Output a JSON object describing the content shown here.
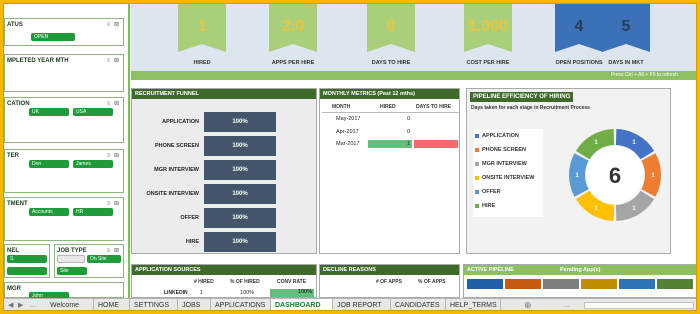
{
  "slicers": [
    {
      "title": "ATUS",
      "chips": [
        "OPEN"
      ]
    },
    {
      "title": "MPLETED YEAR MTH",
      "chips": []
    },
    {
      "title": "CATION",
      "chips": [
        "UK",
        "USA"
      ]
    },
    {
      "title": "TER",
      "chips": [
        "Don",
        "James"
      ]
    },
    {
      "title": "TMENT",
      "chips": [
        "Accounts",
        "HR"
      ]
    },
    {
      "title": "NEL",
      "chips": [
        "S",
        ""
      ]
    },
    {
      "title": "JOB TYPE",
      "chips": [
        "On Site",
        "Site"
      ]
    },
    {
      "title": "MGR",
      "chips": [
        "John"
      ]
    }
  ],
  "slicer_icons": "≡ ⊠",
  "kpis": [
    {
      "value": "1",
      "label": "HIRED",
      "color": "#a9cf7b",
      "text_color": "#e9c43f"
    },
    {
      "value": "2.0",
      "label": "APPS PER HIRE",
      "color": "#a9cf7b",
      "text_color": "#e9c43f"
    },
    {
      "value": "0",
      "label": "DAYS TO HIRE",
      "color": "#a9cf7b",
      "text_color": "#e9c43f"
    },
    {
      "value": "1,000",
      "label": "COST PER HIRE",
      "color": "#a9cf7b",
      "text_color": "#e9c43f"
    },
    {
      "value": "4",
      "label": "OPEN POSITIONS",
      "color": "#3b72b7",
      "text_color": "#2a3c55"
    },
    {
      "value": "5",
      "label": "DAYS IN MKT",
      "color": "#3b72b7",
      "text_color": "#2a3c55"
    }
  ],
  "refresh_hint": "Press Ctrl + Alt + F5 to refresh",
  "funnel": {
    "title": "RECRUITMENT FUNNEL",
    "rows": [
      {
        "label": "APPLICATION",
        "value": "100%"
      },
      {
        "label": "PHONE SCREEN",
        "value": "100%"
      },
      {
        "label": "MGR INTERVIEW",
        "value": "100%"
      },
      {
        "label": "ONSITE INTERVIEW",
        "value": "100%"
      },
      {
        "label": "OFFER",
        "value": "100%"
      },
      {
        "label": "HIRE",
        "value": "100%"
      }
    ]
  },
  "monthly": {
    "title": "MONTHLY METRICS (Past 12 mths)",
    "headers": [
      "MONTH",
      "HIRED",
      "DAYS TO HIRE"
    ],
    "rows": [
      {
        "month": "May-2017",
        "hired": "0",
        "days": ""
      },
      {
        "month": "Apr-2017",
        "hired": "0",
        "days": ""
      },
      {
        "month": "Mar-2017",
        "hired": "1",
        "days": ""
      }
    ]
  },
  "pipeline": {
    "title": "PIPELINE EFFICIENCY OF HIRING",
    "subtitle": "Days taken for each stage in Recruitment Process",
    "center_value": "6",
    "legend": [
      {
        "label": "APPLICATION",
        "color": "#4472c4"
      },
      {
        "label": "PHONE SCREEN",
        "color": "#ed7d31"
      },
      {
        "label": "MGR INTERVIEW",
        "color": "#a5a5a5"
      },
      {
        "label": "ONSITE INTERVIEW",
        "color": "#ffc000"
      },
      {
        "label": "OFFER",
        "color": "#5b9bd5"
      },
      {
        "label": "HIRE",
        "color": "#70ad47"
      }
    ],
    "slice_labels": [
      "1",
      "1",
      "1",
      "1",
      "1",
      "1"
    ]
  },
  "sources": {
    "title": "APPLICATION SOURCES",
    "headers": [
      "# HIRED",
      "% OF HIRED",
      "CONV RATE"
    ],
    "rows": [
      {
        "source": "LINKEDIN",
        "hired": "1",
        "pct": "100%",
        "conv": "100%"
      }
    ]
  },
  "decline": {
    "title": "DECLINE REASONS",
    "headers": [
      "# OF APPS",
      "% OF APPS"
    ]
  },
  "active": {
    "title": "ACTIVE PIPELINE",
    "pending": "Pending App(s)",
    "colors": [
      "#1f5fa8",
      "#c55a11",
      "#7f7f7f",
      "#bf8f00",
      "#2e75b6",
      "#548235"
    ]
  },
  "tabs": {
    "items": [
      "Welcome",
      "HOME",
      "SETTINGS",
      "JOBS",
      "APPLICATIONS",
      "DASHBOARD",
      "JOB REPORT",
      "CANDIDATES",
      "HELP_TERMS"
    ],
    "active": "DASHBOARD",
    "add": "⊕",
    "dots": "..."
  }
}
